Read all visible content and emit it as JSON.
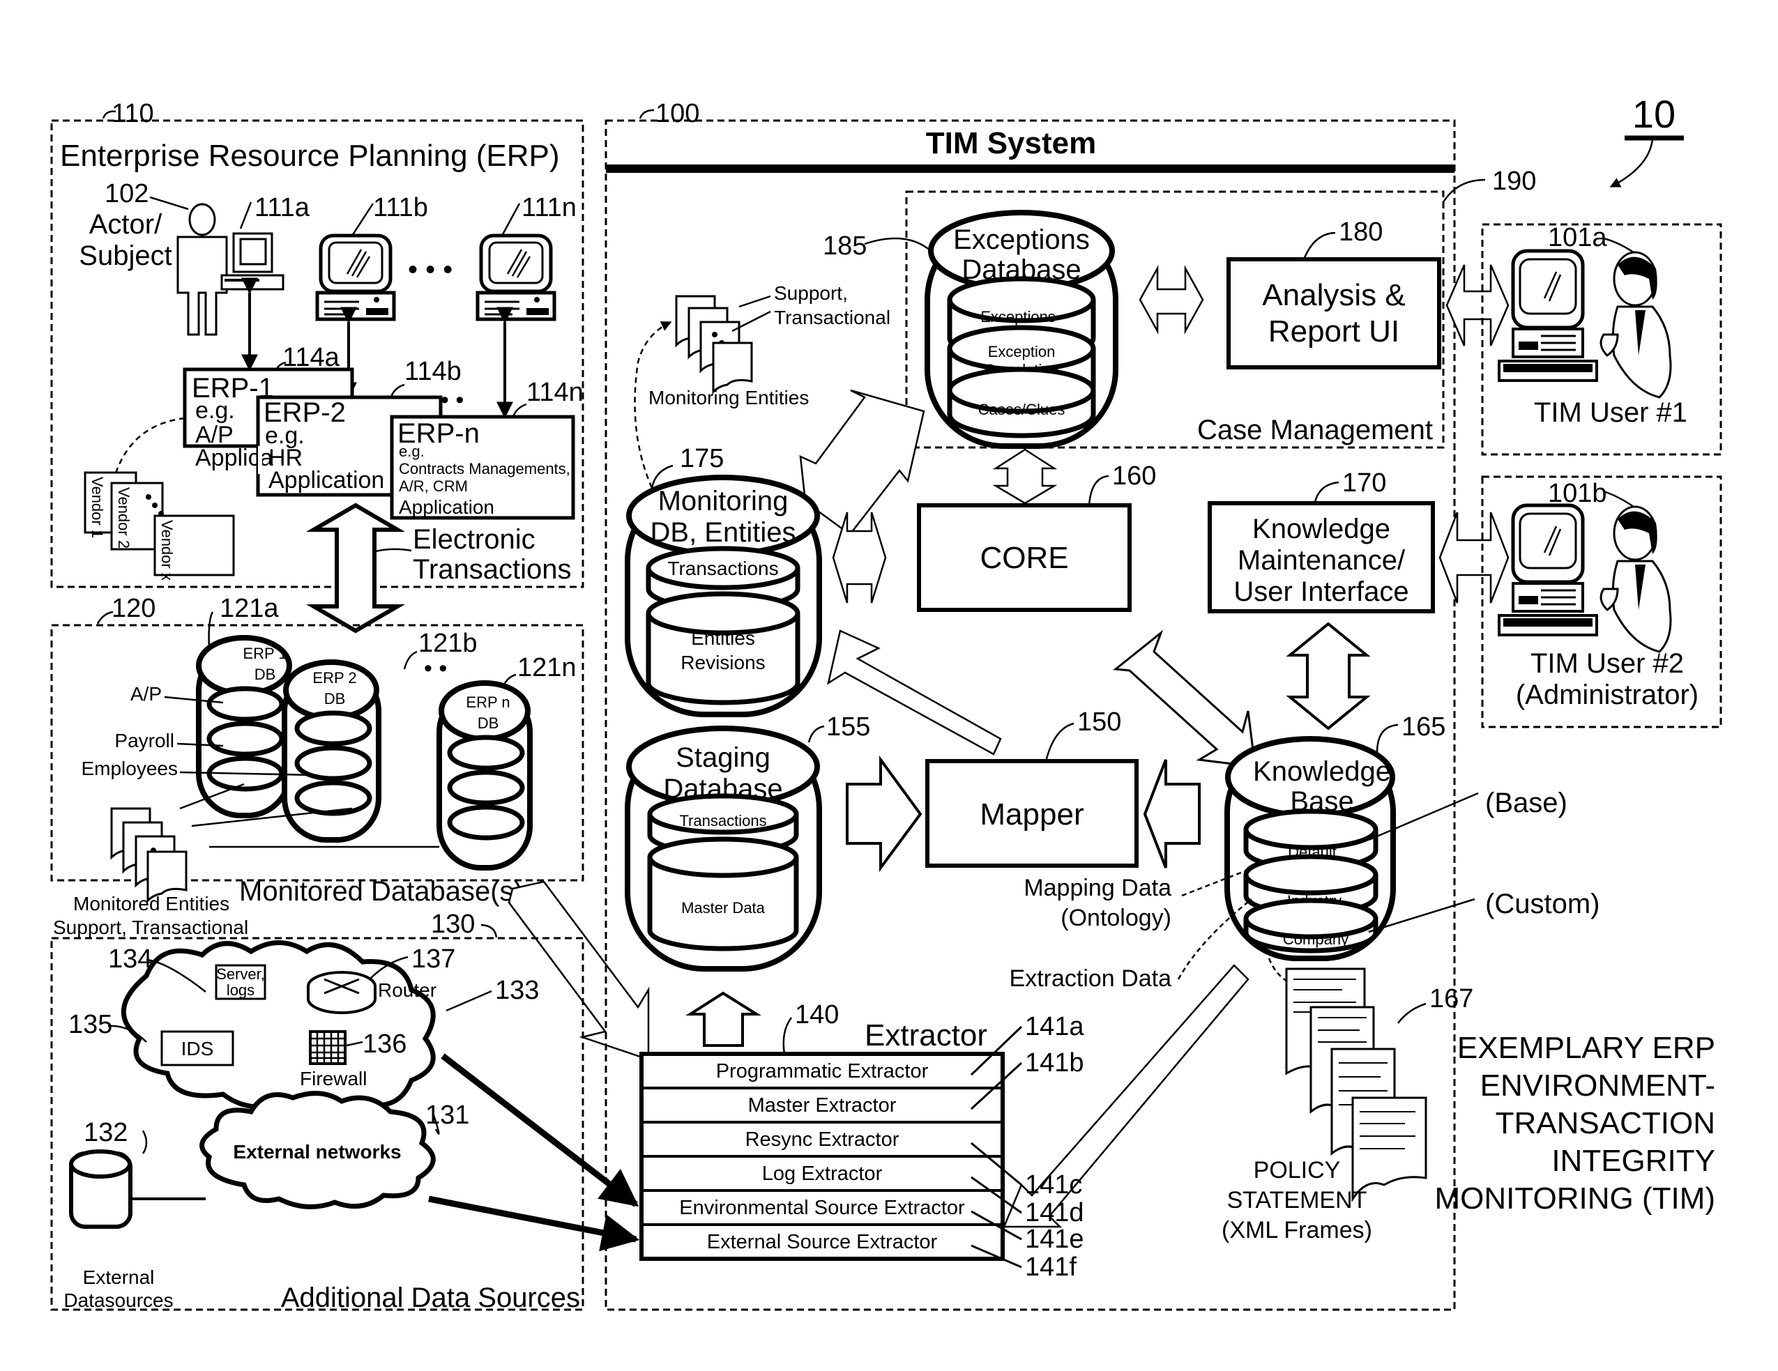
{
  "figure": {
    "figure_ref": "10",
    "title_lines": [
      "EXEMPLARY ERP",
      "ENVIRONMENT-",
      "TRANSACTION",
      "INTEGRITY",
      "MONITORING (TIM)"
    ]
  },
  "erp": {
    "ref": "110",
    "title": "Enterprise Resource Planning (ERP)",
    "actor": {
      "ref": "102",
      "label_line1": "Actor/",
      "label_line2": "Subject"
    },
    "terminals": [
      {
        "ref": "111a"
      },
      {
        "ref": "111b"
      },
      {
        "ref": "111n"
      }
    ],
    "ellipsis": "• • •",
    "apps": [
      {
        "ref": "114a",
        "title": "ERP-1",
        "eg": "e.g.",
        "line1": "A/P",
        "line2": "Applica"
      },
      {
        "ref": "114b",
        "title": "ERP-2",
        "eg": "e.g.",
        "line1": "HR",
        "line2": "Application"
      },
      {
        "ref": "114n",
        "title": "ERP-n",
        "eg": "e.g.",
        "line1": "Contracts Managements,",
        "line2": "A/R, CRM",
        "line3": "Application"
      }
    ],
    "vendors": [
      "Vendor 1",
      "Vendor 2",
      "Vendor x"
    ],
    "electronic_transactions": [
      "Electronic",
      "Transactions"
    ]
  },
  "monitored_db": {
    "ref": "120",
    "title": "Monitored Database(s)",
    "dbs": [
      {
        "ref": "121a",
        "line1": "ERP 1",
        "line2": "DB"
      },
      {
        "ref": "121b",
        "line1": "ERP 2",
        "line2": "DB"
      },
      {
        "ref": "121n",
        "line1": "ERP n",
        "line2": "DB"
      }
    ],
    "layer_labels": [
      "A/P",
      "Payroll",
      "Employees"
    ],
    "entities_label": [
      "Monitored Entities",
      "Support, Transactional"
    ]
  },
  "additional_sources": {
    "ref": "130",
    "title": "Additional Data Sources",
    "env_cloud_ref": "133",
    "server": {
      "ref": "134",
      "line1": "Server,",
      "line2": "logs"
    },
    "router": {
      "ref": "137",
      "label": "Router"
    },
    "ids": {
      "ref": "135",
      "label": "IDS"
    },
    "firewall": {
      "ref": "136",
      "label": "Firewall"
    },
    "external_networks": {
      "ref": "131",
      "label": "External networks"
    },
    "external_ds": {
      "ref": "132",
      "line1": "External",
      "line2": "Datasources"
    }
  },
  "tim": {
    "ref": "100",
    "title": "TIM System",
    "case_management": {
      "ref": "190",
      "label": "Case Management"
    },
    "exceptions_db": {
      "ref": "185",
      "title_line1": "Exceptions",
      "title_line2": "Database",
      "layers": [
        "Exceptions",
        "Exception",
        "Correlation",
        "Cases/Clues"
      ]
    },
    "analysis": {
      "ref": "180",
      "line1": "Analysis &",
      "line2": "Report UI"
    },
    "monitoring_entities": {
      "line1": "Support,",
      "line2": "Transactional",
      "caption": "Monitoring Entities"
    },
    "monitoring_db": {
      "ref": "175",
      "line1": "Monitoring",
      "line2": "DB, Entities",
      "layers": [
        "Transactions",
        "Entities",
        "Revisions"
      ]
    },
    "core": {
      "ref": "160",
      "label": "CORE"
    },
    "knowledge_ui": {
      "ref": "170",
      "line1": "Knowledge",
      "line2": "Maintenance/",
      "line3": "User Interface"
    },
    "staging_db": {
      "ref": "155",
      "line1": "Staging",
      "line2": "Database",
      "layers": [
        "Transactions",
        "Master Data"
      ]
    },
    "mapper": {
      "ref": "150",
      "label": "Mapper"
    },
    "knowledge_base": {
      "ref": "165",
      "line1": "Knowledge",
      "line2": "Base",
      "layers": [
        "Default",
        "Industry",
        "Company"
      ],
      "base_label": "(Base)",
      "custom_label": "(Custom)"
    },
    "mapping_data": [
      "Mapping Data",
      "(Ontology)"
    ],
    "extraction_data": "Extraction Data",
    "policy": {
      "ref": "167",
      "lines": [
        "POLICY",
        "STATEMENT",
        "(XML Frames)"
      ]
    },
    "extractor": {
      "ref": "140",
      "title": "Extractor",
      "rows": [
        {
          "ref": "141a",
          "label": "Programmatic Extractor"
        },
        {
          "ref": "141b",
          "label": "Master Extractor"
        },
        {
          "ref": "141c",
          "label": "Resync Extractor"
        },
        {
          "ref": "141d",
          "label": "Log Extractor"
        },
        {
          "ref": "141e",
          "label": "Environmental Source Extractor"
        },
        {
          "ref": "141f",
          "label": "External Source Extractor"
        }
      ]
    }
  },
  "users": [
    {
      "ref": "101a",
      "label_line1": "TIM User #1",
      "label_line2": ""
    },
    {
      "ref": "101b",
      "label_line1": "TIM User #2",
      "label_line2": "(Administrator)"
    }
  ]
}
